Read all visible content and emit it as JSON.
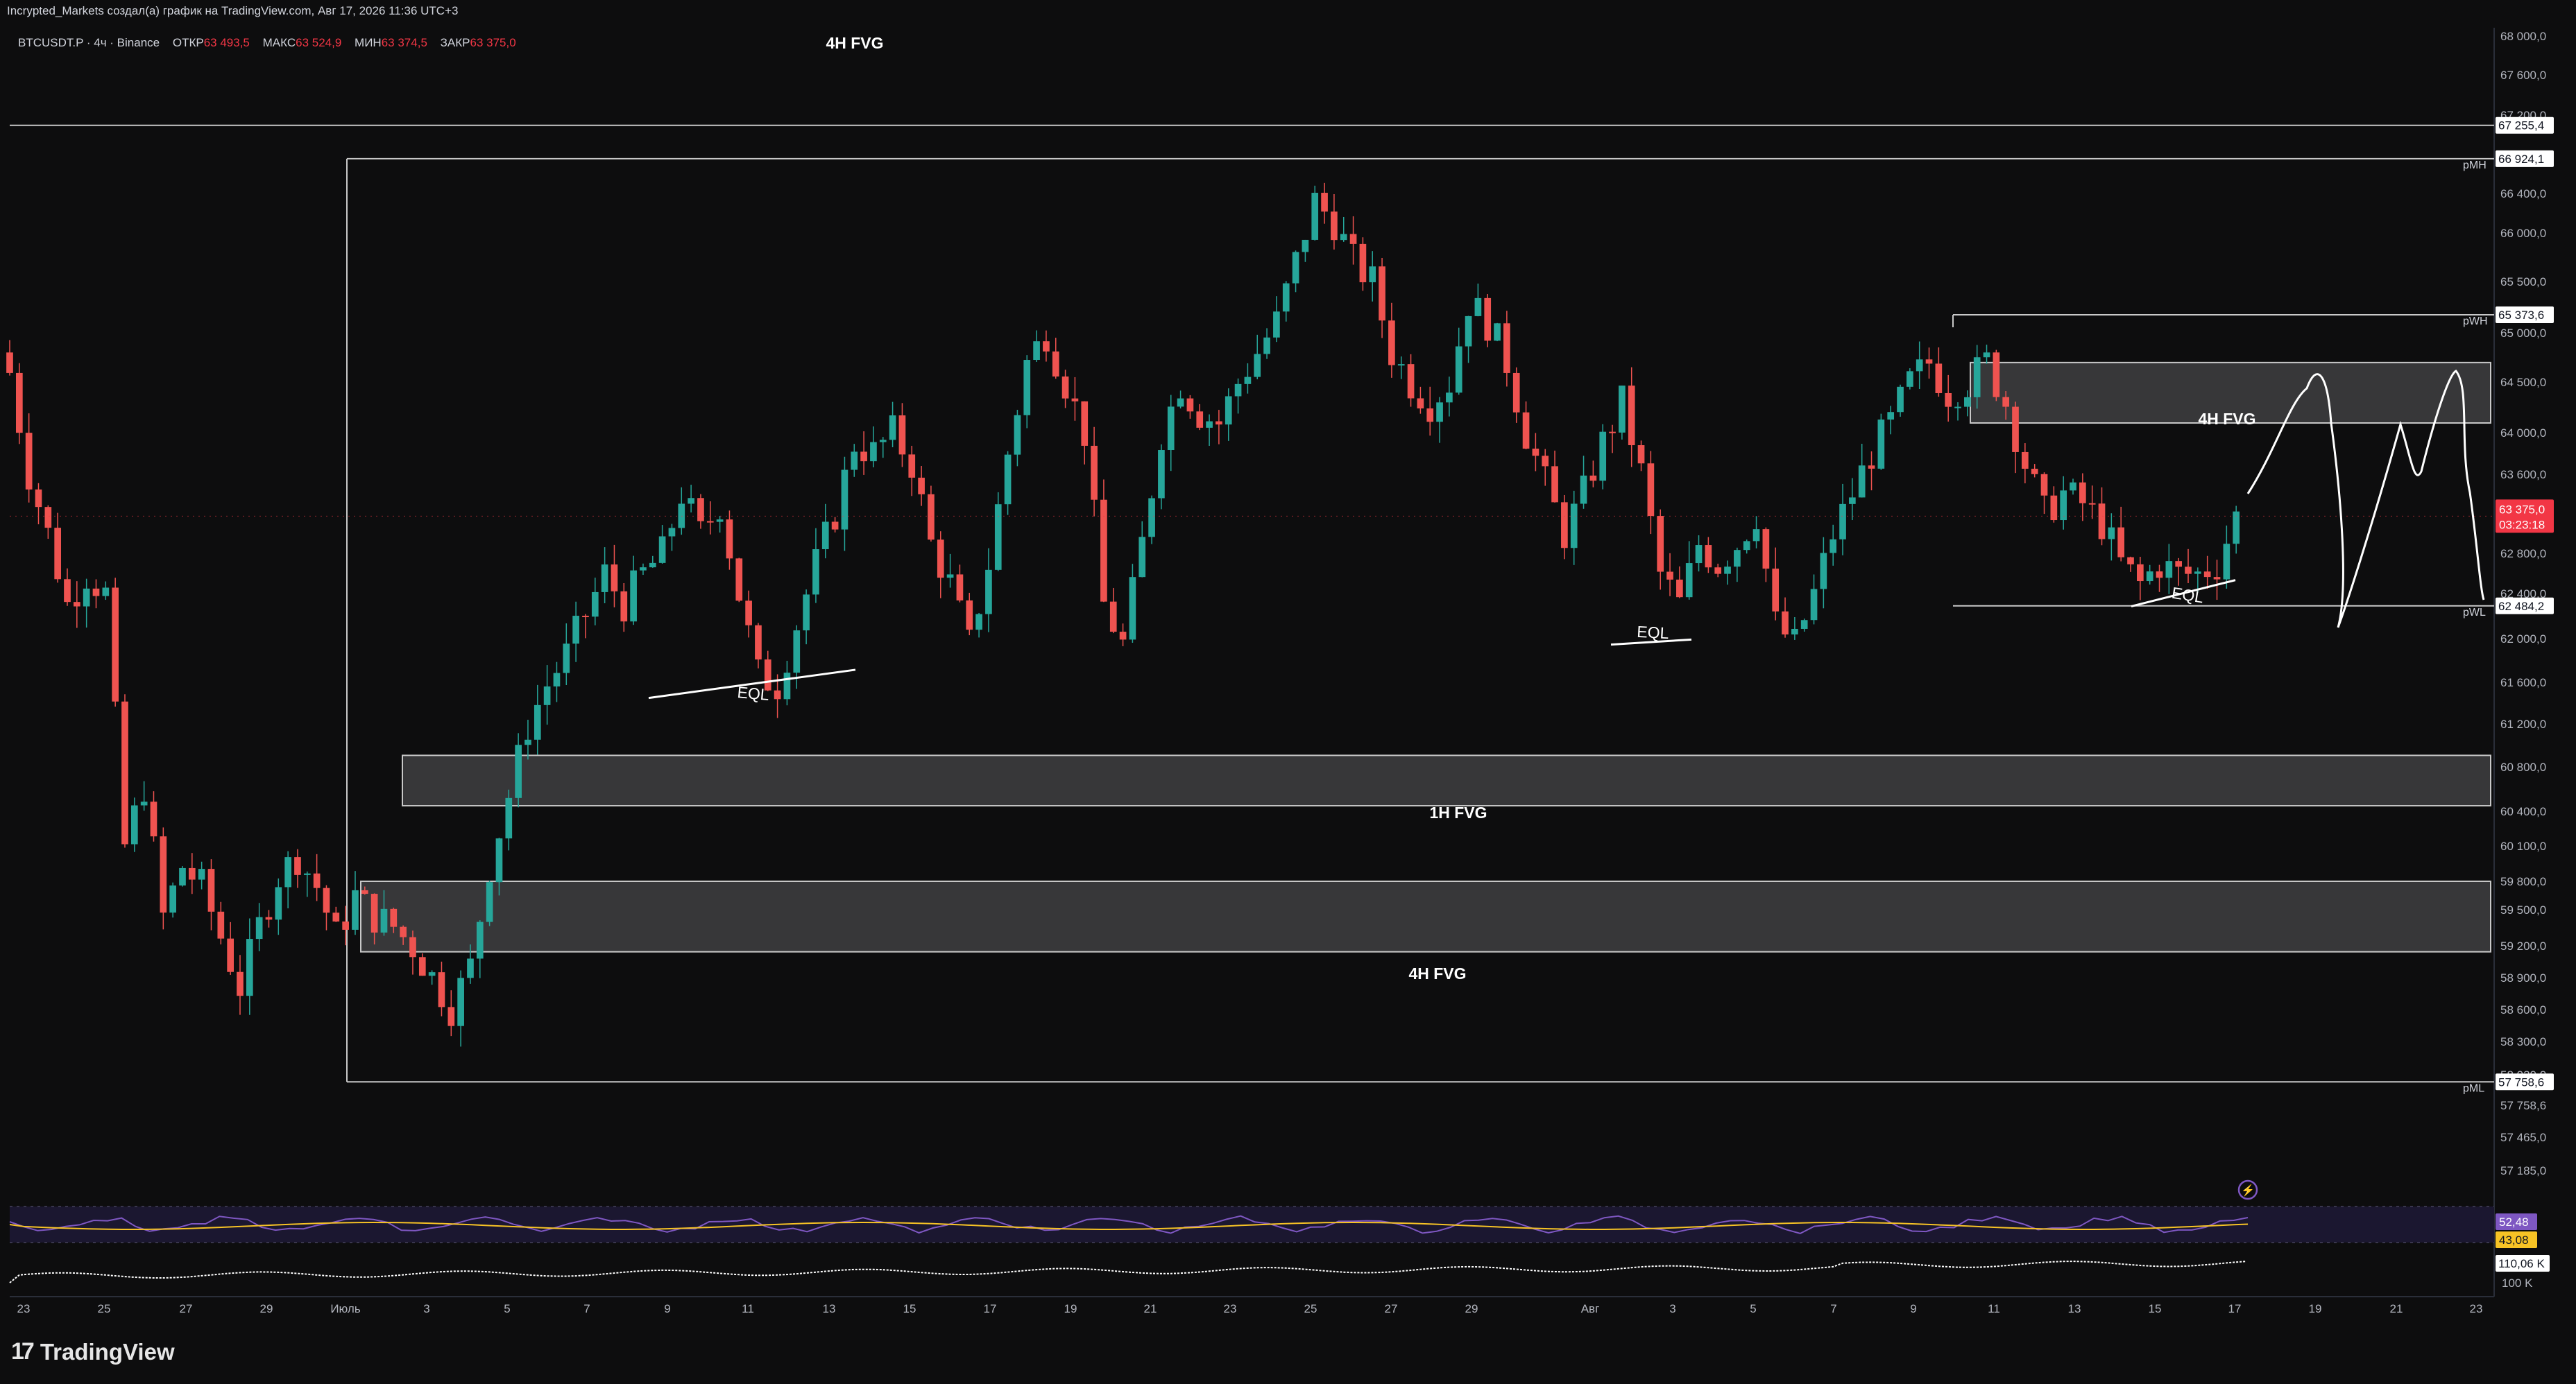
{
  "header": {
    "author_line": "Incrypted_Markets создал(а) график на TradingView.com, Авг 17, 2026 11:36 UTC+3"
  },
  "symbol_bar": {
    "symbol": "BTCUSDT.P · 4ч · Binance",
    "open_label": "ОТКР",
    "open": "63 493,5",
    "high_label": "МАКС",
    "high": "63 524,9",
    "low_label": "МИН",
    "low": "63 374,5",
    "close_label": "ЗАКР",
    "close": "63 375,0"
  },
  "colors": {
    "background": "#0d0d0e",
    "up": "#26a69a",
    "down": "#ef5350",
    "zone_fill": "#3c3c3e",
    "zone_border": "#c8c8c8",
    "axis_text": "#b2b5be",
    "price_tag": "#f23645",
    "rsi_line": "#7e57c2",
    "rsi_ma": "#f7c325"
  },
  "chart_data": {
    "type": "candlestick",
    "timeframe": "4ч",
    "y_range": [
      56900,
      68100
    ],
    "price_ticks": [
      "68 000,0",
      "67 600,0",
      "67 200,0",
      "66 800,0",
      "66 400,0",
      "66 000,0",
      "65 500,0",
      "65 000,0",
      "64 500,0",
      "64 000,0",
      "63 600,0",
      "63 200,0",
      "62 800,0",
      "62 400,0",
      "62 000,0",
      "61 600,0",
      "61 200,0",
      "60 800,0",
      "60 400,0",
      "60 100,0",
      "59 800,0",
      "59 500,0",
      "59 200,0",
      "58 900,0",
      "58 600,0",
      "58 300,0",
      "58 020,0",
      "57 758,6",
      "57 465,0",
      "57 185,0"
    ],
    "date_ticks": [
      "23",
      "25",
      "27",
      "29",
      "Июль",
      "3",
      "5",
      "7",
      "9",
      "11",
      "13",
      "15",
      "17",
      "19",
      "21",
      "23",
      "25",
      "27",
      "29",
      "Авг",
      "3",
      "5",
      "7",
      "9",
      "11",
      "13",
      "15",
      "17",
      "19",
      "21",
      "23"
    ],
    "price_tags": [
      {
        "label": "67 255,4",
        "price": 67255.4
      },
      {
        "label": "66 924,1",
        "price": 66924.1
      },
      {
        "label": "65 373,6",
        "price": 65373.6
      },
      {
        "label": "62 484,2",
        "price": 62484.2
      },
      {
        "label": "57 758,6",
        "price": 57758.6
      }
    ],
    "current_price": {
      "label": "63 375,0",
      "timer": "03:23:18",
      "price": 63375
    },
    "approx_close_path": [
      [
        0,
        64800
      ],
      [
        2,
        63800
      ],
      [
        4,
        63200
      ],
      [
        6,
        62500
      ],
      [
        8,
        62800
      ],
      [
        10,
        62600
      ],
      [
        12,
        60100
      ],
      [
        14,
        60700
      ],
      [
        16,
        59400
      ],
      [
        18,
        59900
      ],
      [
        20,
        59700
      ],
      [
        22,
        59200
      ],
      [
        24,
        58700
      ],
      [
        26,
        59300
      ],
      [
        28,
        59800
      ],
      [
        30,
        60000
      ],
      [
        32,
        59700
      ],
      [
        34,
        59200
      ],
      [
        36,
        59600
      ],
      [
        38,
        59400
      ],
      [
        40,
        59300
      ],
      [
        42,
        59100
      ],
      [
        44,
        58800
      ],
      [
        46,
        58500
      ],
      [
        48,
        58900
      ],
      [
        50,
        59900
      ],
      [
        52,
        60600
      ],
      [
        54,
        61300
      ],
      [
        56,
        61700
      ],
      [
        58,
        62000
      ],
      [
        60,
        62400
      ],
      [
        62,
        62800
      ],
      [
        64,
        62500
      ],
      [
        66,
        62800
      ],
      [
        68,
        63000
      ],
      [
        70,
        63600
      ],
      [
        72,
        63200
      ],
      [
        74,
        63500
      ],
      [
        76,
        62600
      ],
      [
        78,
        61800
      ],
      [
        80,
        61700
      ],
      [
        82,
        62300
      ],
      [
        84,
        62900
      ],
      [
        86,
        63400
      ],
      [
        88,
        64100
      ],
      [
        90,
        64000
      ],
      [
        92,
        64200
      ],
      [
        94,
        63900
      ],
      [
        96,
        63100
      ],
      [
        98,
        62700
      ],
      [
        100,
        62100
      ],
      [
        102,
        62900
      ],
      [
        104,
        64000
      ],
      [
        106,
        64900
      ],
      [
        108,
        65200
      ],
      [
        110,
        64700
      ],
      [
        112,
        64200
      ],
      [
        114,
        62500
      ],
      [
        116,
        62100
      ],
      [
        118,
        63100
      ],
      [
        120,
        64200
      ],
      [
        122,
        64700
      ],
      [
        124,
        64400
      ],
      [
        126,
        64300
      ],
      [
        128,
        64700
      ],
      [
        130,
        65000
      ],
      [
        132,
        65300
      ],
      [
        134,
        65900
      ],
      [
        136,
        66500
      ],
      [
        138,
        66300
      ],
      [
        140,
        65900
      ],
      [
        142,
        65700
      ],
      [
        144,
        65000
      ],
      [
        146,
        64700
      ],
      [
        148,
        64500
      ],
      [
        150,
        64700
      ],
      [
        152,
        65500
      ],
      [
        154,
        65300
      ],
      [
        156,
        64900
      ],
      [
        158,
        64200
      ],
      [
        160,
        63700
      ],
      [
        162,
        63200
      ],
      [
        164,
        63600
      ],
      [
        166,
        64100
      ],
      [
        168,
        64500
      ],
      [
        170,
        63800
      ],
      [
        172,
        62800
      ],
      [
        174,
        62500
      ],
      [
        176,
        63100
      ],
      [
        178,
        62900
      ],
      [
        180,
        63100
      ],
      [
        182,
        63400
      ],
      [
        184,
        62300
      ],
      [
        186,
        62100
      ],
      [
        188,
        62600
      ],
      [
        190,
        63200
      ],
      [
        192,
        63600
      ],
      [
        194,
        64000
      ],
      [
        196,
        64300
      ],
      [
        198,
        64700
      ],
      [
        200,
        64900
      ],
      [
        202,
        64600
      ],
      [
        204,
        64700
      ],
      [
        206,
        64900
      ],
      [
        208,
        64500
      ],
      [
        210,
        63900
      ],
      [
        212,
        63400
      ],
      [
        214,
        63600
      ],
      [
        216,
        63500
      ],
      [
        218,
        63300
      ],
      [
        220,
        62900
      ],
      [
        222,
        62700
      ],
      [
        224,
        62900
      ],
      [
        226,
        62800
      ],
      [
        228,
        62800
      ],
      [
        230,
        62900
      ],
      [
        232,
        63375
      ]
    ],
    "zones": [
      {
        "label": "4H FVG",
        "top": 64900,
        "bottom": 64300
      },
      {
        "label": "1H FVG",
        "top": 61000,
        "bottom": 60500
      },
      {
        "label": "4H FVG",
        "top": 59750,
        "bottom": 59050
      }
    ],
    "level_labels": [
      "pWH",
      "pWL",
      "pMH",
      "pML"
    ],
    "annotations": [
      "4H FVG",
      "EQL",
      "EQL",
      "EQL"
    ],
    "rsi": {
      "value": "52,48",
      "ma": "43,08"
    },
    "volume": {
      "last": "110,06 K",
      "scale": "100 K"
    }
  },
  "brand": {
    "logo": "17",
    "name": "TradingView"
  }
}
